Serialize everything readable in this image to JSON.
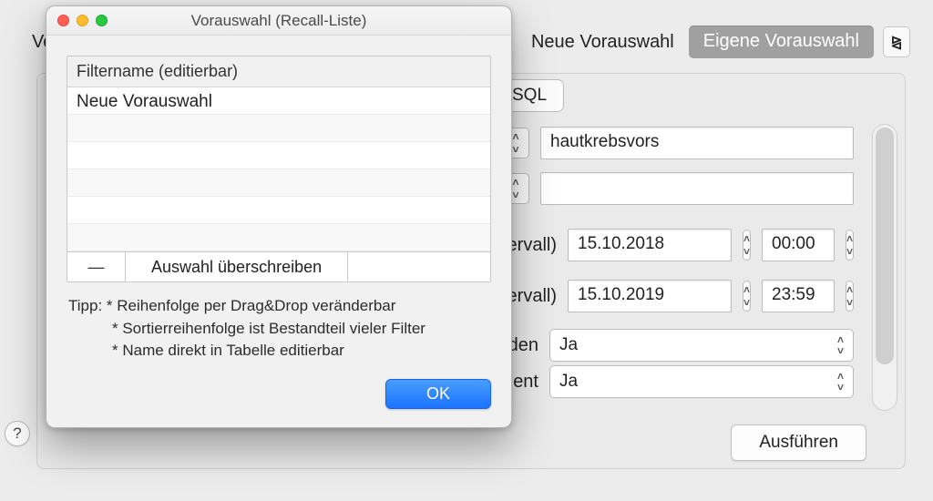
{
  "bg": {
    "vo_prefix": "Vo",
    "neue_vorauswahl": "Neue Vorauswahl",
    "eigene_vorauswahl": "Eigene Vorauswahl",
    "sql_tab": "SQL",
    "execute_label": "Ausführen",
    "help_label": "?",
    "text1_value": "hautkrebsvors",
    "text2_value": "",
    "row3_label_tail": "ervall)",
    "row3_date": "15.10.2018",
    "row3_time": "00:00",
    "row4_label_tail": "ervall)",
    "row4_date": "15.10.2019",
    "row4_time": "23:59",
    "row5_label_tail": "den",
    "row5_value": "Ja",
    "row6_label_tail": "ent",
    "row6_value": "Ja"
  },
  "dialog": {
    "title": "Vorauswahl (Recall-Liste)",
    "table_header": "Filtername (editierbar)",
    "rows": [
      "Neue Vorauswahl",
      "",
      "",
      "",
      "",
      ""
    ],
    "minus": "—",
    "overwrite": "Auswahl überschreiben",
    "tip_label": "Tipp:",
    "tip1": "* Reihenfolge per Drag&Drop veränderbar",
    "tip2": "* Sortierreihenfolge ist Bestandteil vieler Filter",
    "tip3": "* Name direkt in Tabelle editierbar",
    "ok": "OK"
  }
}
